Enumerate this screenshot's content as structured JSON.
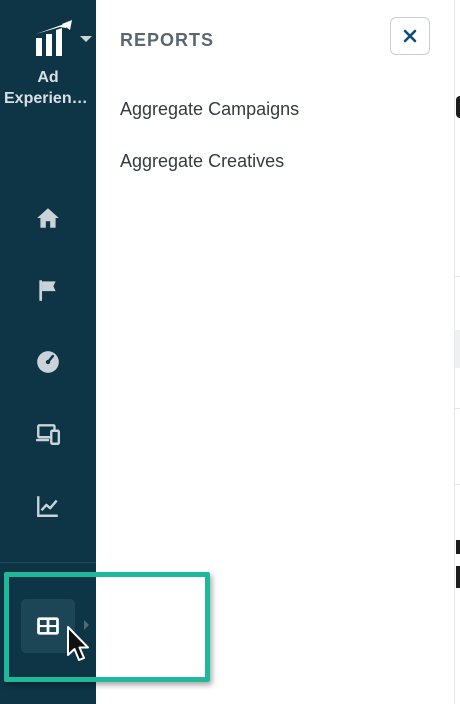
{
  "sidebar": {
    "brand": {
      "label_line1": "Ad",
      "label_line2": "Experienc...",
      "logo_icon": "brand-logo-icon",
      "caret_icon": "chevron-down-icon"
    },
    "items": [
      {
        "name": "home",
        "icon": "home-icon"
      },
      {
        "name": "campaigns",
        "icon": "flag-icon"
      },
      {
        "name": "performance",
        "icon": "gauge-icon"
      },
      {
        "name": "devices",
        "icon": "devices-icon"
      },
      {
        "name": "analytics",
        "icon": "line-chart-icon"
      },
      {
        "name": "reports",
        "icon": "table-icon",
        "active": true
      }
    ],
    "colors": {
      "background": "#0d3545",
      "icon": "#c9d3d8",
      "active_background": "#1c4656"
    }
  },
  "flyout": {
    "title": "REPORTS",
    "close_icon": "close-icon",
    "links": [
      {
        "label": "Aggregate Campaigns"
      },
      {
        "label": "Aggregate Creatives"
      }
    ]
  },
  "overlay": {
    "highlight_color": "#20b89a",
    "cursor_icon": "mouse-pointer-icon"
  }
}
